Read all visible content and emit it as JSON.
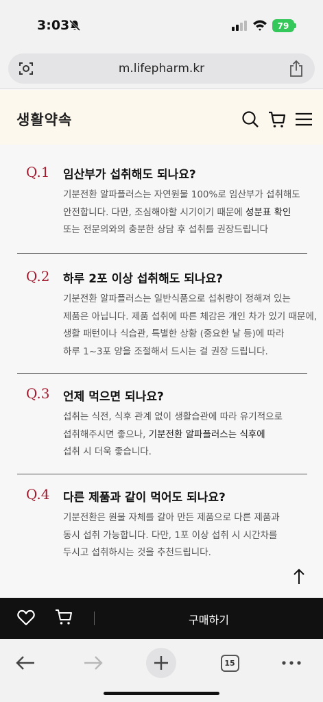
{
  "status": {
    "time": "3:03",
    "battery": "79"
  },
  "browser": {
    "url": "m.lifepharm.kr",
    "tab_count": "15"
  },
  "site": {
    "logo": "생활약속"
  },
  "faqs": [
    {
      "num": "Q.1",
      "question": "임산부가 섭취해도 되나요?",
      "lines": [
        "기분전환 알파플러스는 자연원물 100%로 임산부가 섭취해도",
        "안전합니다. 다만, 조심해야할 시기이기 때문에 ",
        "또는 전문의와의 충분한 상담 후 섭취를 권장드립니다"
      ],
      "emphasis": "성분표 확인"
    },
    {
      "num": "Q.2",
      "question": "하루 2포 이상 섭취해도 되나요?",
      "lines": [
        "기분전환 알파플러스는 일반식품으로 섭취량이 정해져 있는",
        "제품은 아닙니다. 제품 섭취에 따른 체감은 개인 차가 있기 때문에,",
        "생활 패턴이나 식습관, 특별한 상황 (중요한 날 등)에 따라",
        "하루 1~3포 양을 조절해서 드시는 걸 권장 드립니다."
      ]
    },
    {
      "num": "Q.3",
      "question": "언제 먹으면 되나요?",
      "lines": [
        "섭취는 식전, 식후 관계 없이 생활습관에 따라 유기적으로",
        "섭취해주시면 좋으나, ",
        "섭취 시 더욱 좋습니다."
      ],
      "emphasis": "기분전환 알파플러스는 식후에"
    },
    {
      "num": "Q.4",
      "question": "다른 제품과 같이 먹어도 되나요?",
      "lines": [
        "기분전환은 원물 자체를 갈아 만든 제품으로 다른 제품과",
        "동시 섭취 가능합니다. 다만, 1포 이상 섭취 시 시간차를",
        "두시고 섭취하시는 것을 추천드립니다."
      ]
    }
  ],
  "buy_bar": {
    "label": "구매하기"
  }
}
